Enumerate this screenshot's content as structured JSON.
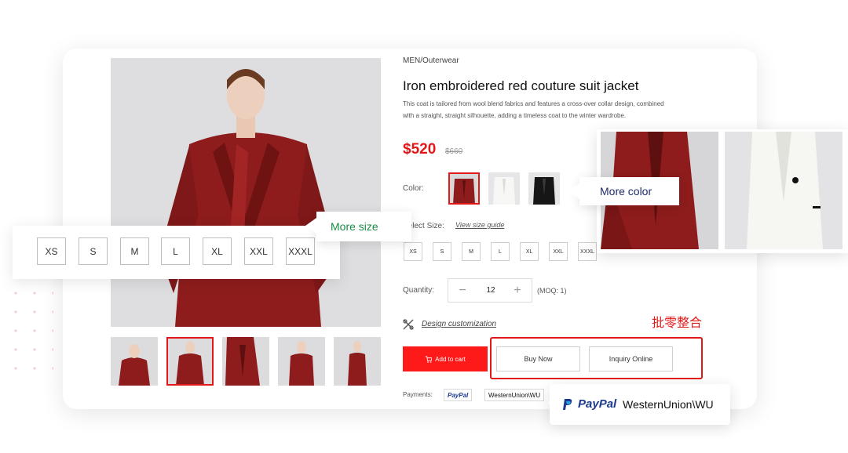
{
  "product": {
    "category": "MEN/Outerwear",
    "title": "Iron embroidered red couture suit jacket",
    "description": "This coat is tailored from wool blend fabrics and features a cross-over collar design, combined with a straight, straight silhouette, adding a timeless coat to the winter wardrobe.",
    "price": "$520",
    "old_price": "$660"
  },
  "labels": {
    "color": "Color:",
    "select_size": "Select Size:",
    "size_guide": "View size guide",
    "quantity": "Quantity:",
    "moq": "(MOQ: 1)",
    "design": "Design customization",
    "payments": "Payments:"
  },
  "sizes": [
    "XS",
    "S",
    "M",
    "L",
    "XL",
    "XXL",
    "XXXL"
  ],
  "quantity": {
    "minus": "−",
    "value": "12",
    "plus": "+"
  },
  "buttons": {
    "add_to_cart": "Add to cart",
    "buy_now": "Buy Now",
    "inquiry": "Inquiry Online"
  },
  "payment_methods": {
    "paypal": "PayPal",
    "western_union": "WesternUnion\\WU"
  },
  "annotations": {
    "more_size": "More size",
    "more_color": "More  color",
    "wholesale_retail": "批零整合"
  },
  "colors": {
    "accent": "#e21818",
    "cart_button": "#ff1a1a",
    "jacket_red": "#8e1c1c",
    "more_size_text": "#1a8a46",
    "more_color_text": "#1f2a6e",
    "paypal_blue": "#1b3a8f"
  },
  "thumbnails": {
    "selected_index": 1
  },
  "swatches": {
    "selected_index": 0,
    "names": [
      "red",
      "white",
      "black"
    ]
  }
}
